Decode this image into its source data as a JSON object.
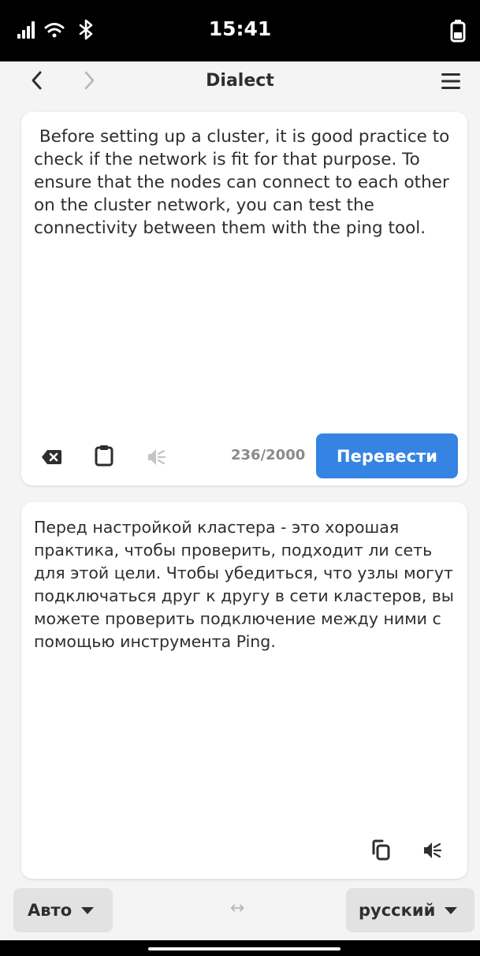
{
  "status_bar": {
    "time": "15:41",
    "icons": [
      "signal-icon",
      "wifi-icon",
      "bluetooth-icon",
      "battery-icon"
    ]
  },
  "header": {
    "title": "Dialect"
  },
  "source": {
    "text": " Before setting up a cluster, it is good practice to check if the network is fit for that purpose. To ensure that the nodes can connect to each other on the cluster network, you can test the connectivity between them with the ping tool.",
    "counter": "236/2000",
    "translate_label": "Перевести"
  },
  "target": {
    "text": "Перед настройкой кластера - это хорошая практика, чтобы проверить, подходит ли сеть для этой цели. Чтобы убедиться, что узлы могут подключаться друг к другу в сети кластеров, вы можете проверить подключение между ними с помощью инструмента Ping."
  },
  "languages": {
    "from": "Авто",
    "to": "русский",
    "swap_symbol": "↔"
  },
  "colors": {
    "accent": "#3584e4",
    "card": "#ffffff",
    "background": "#f4f4f4"
  }
}
